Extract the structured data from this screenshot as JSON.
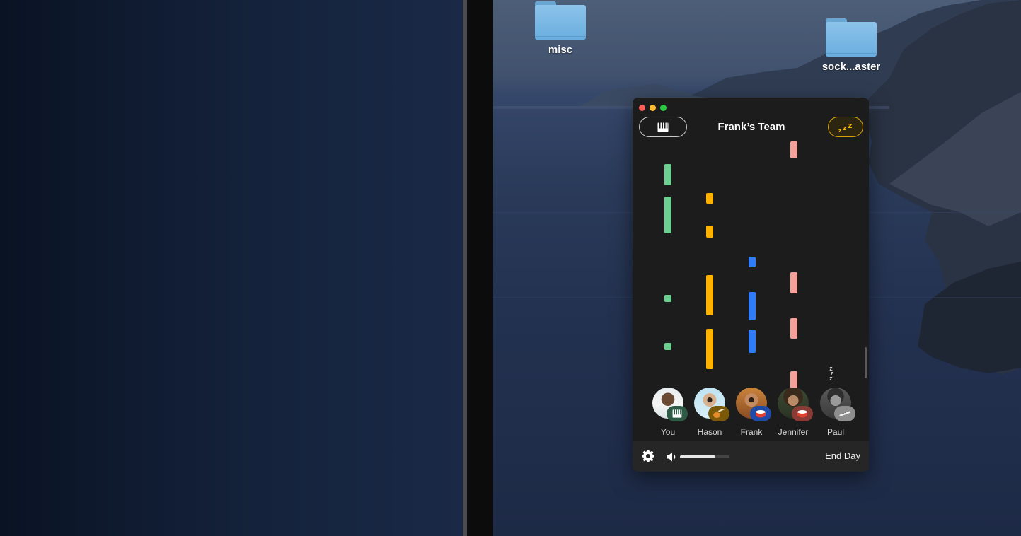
{
  "desktop": {
    "folders": [
      {
        "label": "misc"
      },
      {
        "label": "sock...aster"
      }
    ]
  },
  "app": {
    "title": "Frank’s Team",
    "instrument_button_icon": "piano-icon",
    "sleep_button_icon": "zzz-icon",
    "note_columns": [
      {
        "member": "You",
        "color": "#6ccf8f"
      },
      {
        "member": "Hason",
        "color": "#ffb300"
      },
      {
        "member": "Frank",
        "color": "#2f7cf6"
      },
      {
        "member": "Jennifer",
        "color": "#f5a19a"
      }
    ],
    "members": [
      {
        "name": "You",
        "instrument": "piano-icon",
        "badge_color": "#2e5b45"
      },
      {
        "name": "Hason",
        "instrument": "guitar-icon",
        "badge_color": "#7a5a08"
      },
      {
        "name": "Frank",
        "instrument": "drum-icon",
        "badge_color": "#1f4aa8"
      },
      {
        "name": "Jennifer",
        "instrument": "drum-icon",
        "badge_color": "#8a3b36"
      },
      {
        "name": "Paul",
        "instrument": "flute-icon",
        "badge_color": "#8e8e8e",
        "sleeping": true
      }
    ],
    "footer": {
      "settings_icon": "gear-icon",
      "volume_icon": "speaker-icon",
      "volume_level": 0.72,
      "end_day_label": "End Day"
    }
  }
}
